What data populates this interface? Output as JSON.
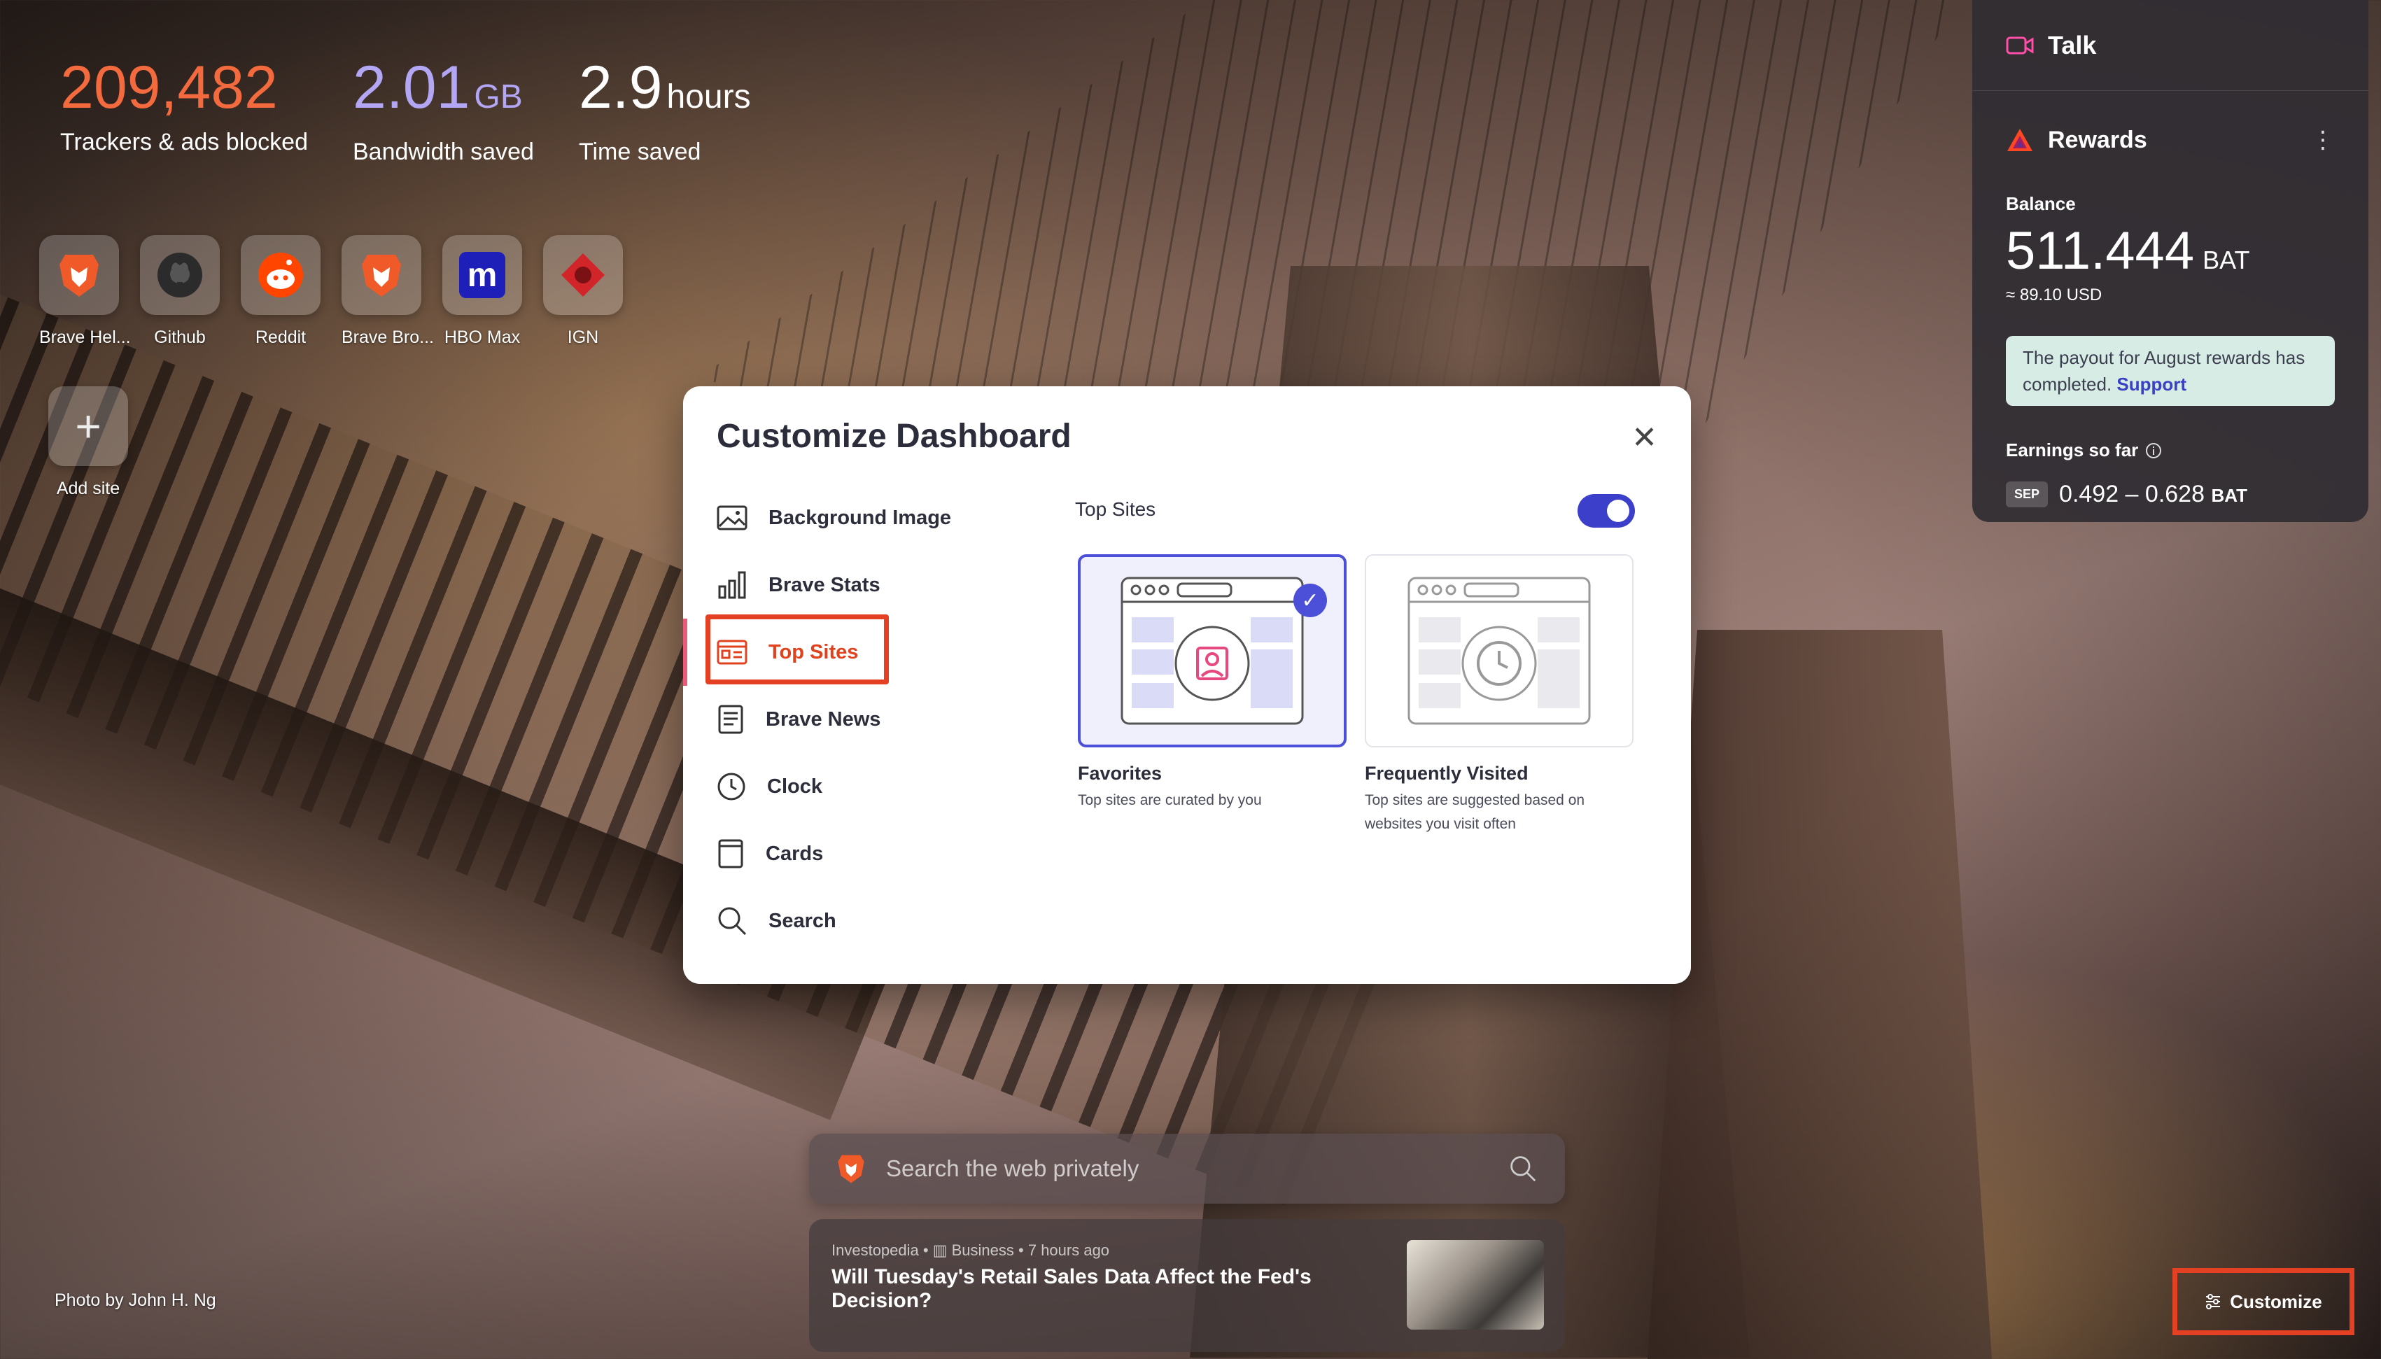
{
  "stats": {
    "trackers_value": "209,482",
    "trackers_label": "Trackers & ads blocked",
    "bandwidth_value": "2.01",
    "bandwidth_unit": "GB",
    "bandwidth_label": "Bandwidth saved",
    "time_value": "2.9",
    "time_unit": "hours",
    "time_label": "Time saved"
  },
  "top_sites": [
    {
      "name": "Brave Hel...",
      "icon": "brave-lion-icon"
    },
    {
      "name": "Github",
      "icon": "github-icon"
    },
    {
      "name": "Reddit",
      "icon": "reddit-icon"
    },
    {
      "name": "Brave Bro...",
      "icon": "brave-lion-icon"
    },
    {
      "name": "HBO Max",
      "icon": "hbo-max-icon",
      "glyph": "m"
    },
    {
      "name": "IGN",
      "icon": "ign-icon"
    }
  ],
  "add_site": {
    "label": "Add site",
    "glyph": "+"
  },
  "rewards": {
    "talk_label": "Talk",
    "title": "Rewards",
    "menu_glyph": "⋮",
    "balance_label": "Balance",
    "balance_value": "511.444",
    "balance_unit": "BAT",
    "balance_usd": "≈ 89.10 USD",
    "payout_text": "The payout for August rewards has completed.",
    "payout_link": "Support",
    "earnings_label": "Earnings so far",
    "earnings_month": "SEP",
    "earnings_range": "0.492 – 0.628",
    "earnings_unit": "BAT"
  },
  "modal": {
    "title": "Customize Dashboard",
    "close_glyph": "✕",
    "nav": [
      {
        "label": "Background Image",
        "icon": "image-icon"
      },
      {
        "label": "Brave Stats",
        "icon": "bar-chart-icon"
      },
      {
        "label": "Top Sites",
        "icon": "top-sites-icon",
        "active": true
      },
      {
        "label": "Brave News",
        "icon": "news-icon"
      },
      {
        "label": "Clock",
        "icon": "clock-icon"
      },
      {
        "label": "Cards",
        "icon": "cards-icon"
      },
      {
        "label": "Search",
        "icon": "search-icon"
      }
    ],
    "section_title": "Top Sites",
    "toggle_on": true,
    "options": [
      {
        "name": "Favorites",
        "desc": "Top sites are curated by you",
        "selected": true
      },
      {
        "name": "Frequently Visited",
        "desc": "Top sites are suggested based on websites you visit often",
        "selected": false
      }
    ]
  },
  "search": {
    "placeholder": "Search the web privately"
  },
  "news": {
    "source": "Investopedia",
    "category": "Business",
    "time": "7 hours ago",
    "title": "Will Tuesday's Retail Sales Data Affect the Fed's Decision?"
  },
  "photo_credit": "Photo by John H. Ng",
  "customize_label": "Customize",
  "colors": {
    "accent": "#4c4fd7",
    "brand_orange": "#f26a3d",
    "highlight": "#e44124"
  }
}
